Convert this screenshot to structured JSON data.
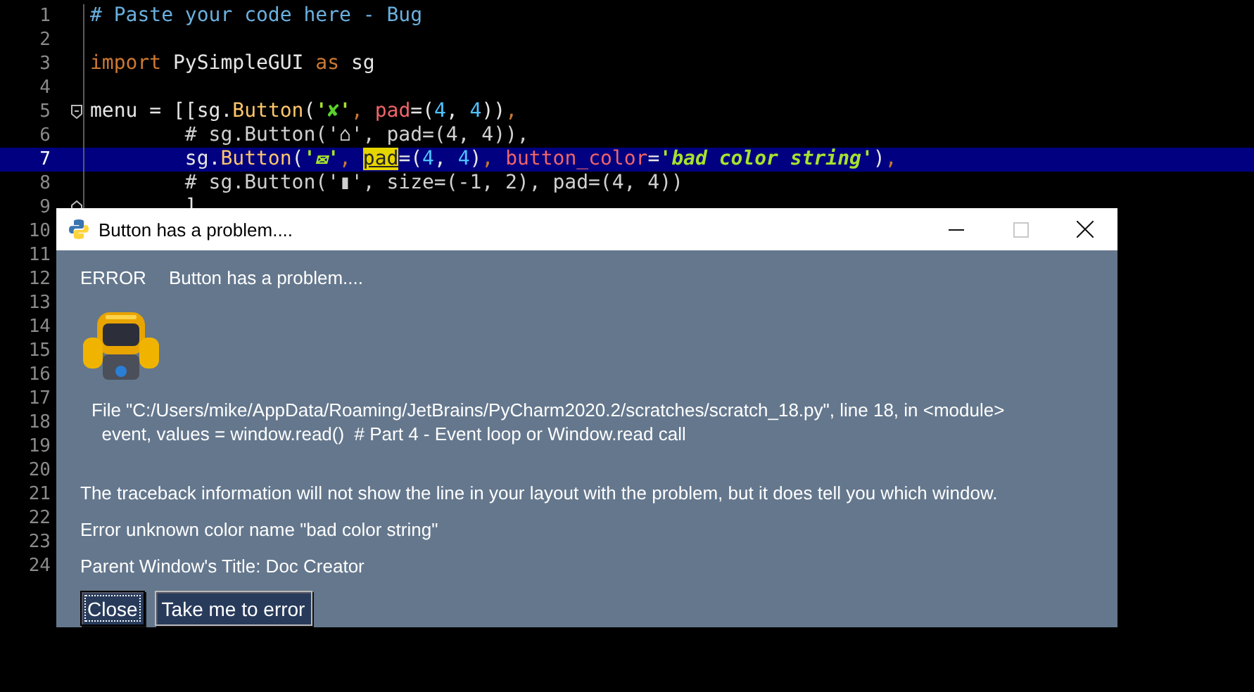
{
  "editor": {
    "lines": [
      {
        "number": "1",
        "selected": false,
        "tokens": [
          {
            "kind": "comment",
            "text": "# Paste your code here - Bug"
          }
        ]
      },
      {
        "number": "2",
        "selected": false
      },
      {
        "number": "3",
        "selected": false,
        "tokens": [
          {
            "kind": "keyword",
            "text": "import"
          },
          {
            "kind": "plain",
            "text": " PySimpleGUI "
          },
          {
            "kind": "keyword",
            "text": "as"
          },
          {
            "kind": "plain",
            "text": " sg"
          }
        ]
      },
      {
        "number": "4",
        "selected": false
      },
      {
        "number": "5",
        "selected": false,
        "fold_start": true,
        "tokens": [
          {
            "kind": "plain",
            "text": "menu = [[sg."
          },
          {
            "kind": "func",
            "text": "Button"
          },
          {
            "kind": "plain",
            "text": "("
          },
          {
            "kind": "string",
            "text": "'"
          },
          {
            "kind": "mark",
            "text": "✘"
          },
          {
            "kind": "string",
            "text": "'"
          },
          {
            "kind": "punct",
            "text": ", "
          },
          {
            "kind": "param",
            "text": "pad"
          },
          {
            "kind": "plain",
            "text": "=("
          },
          {
            "kind": "number",
            "text": "4"
          },
          {
            "kind": "plain",
            "text": ", "
          },
          {
            "kind": "number",
            "text": "4"
          },
          {
            "kind": "plain",
            "text": "))"
          },
          {
            "kind": "punct",
            "text": ","
          }
        ]
      },
      {
        "number": "6",
        "selected": false,
        "tokens": [
          {
            "kind": "commented",
            "text": "        # sg.Button('⌂', pad=(4, 4)),"
          }
        ]
      },
      {
        "number": "7",
        "selected": true,
        "tokens": [
          {
            "kind": "plain",
            "text": "        sg."
          },
          {
            "kind": "func",
            "text": "Button"
          },
          {
            "kind": "plain",
            "text": "("
          },
          {
            "kind": "string",
            "text": "'✉'"
          },
          {
            "kind": "punct",
            "text": ", "
          },
          {
            "kind": "match",
            "text": "pad"
          },
          {
            "kind": "plain",
            "text": "=("
          },
          {
            "kind": "number",
            "text": "4"
          },
          {
            "kind": "plain",
            "text": ", "
          },
          {
            "kind": "number",
            "text": "4"
          },
          {
            "kind": "plain",
            "text": ")"
          },
          {
            "kind": "punct",
            "text": ", "
          },
          {
            "kind": "param",
            "text": "button_color"
          },
          {
            "kind": "plain",
            "text": "="
          },
          {
            "kind": "string",
            "text": "'bad color string'"
          },
          {
            "kind": "plain",
            "text": ")"
          },
          {
            "kind": "punct",
            "text": ","
          }
        ]
      },
      {
        "number": "8",
        "selected": false,
        "tokens": [
          {
            "kind": "commented",
            "text": "        # sg.Button('▮', size=(-1, 2), pad=(4, 4))"
          }
        ]
      },
      {
        "number": "9",
        "selected": false,
        "fold_end": true,
        "tokens": [
          {
            "kind": "plain",
            "text": "        ]"
          }
        ]
      },
      {
        "number": "10",
        "selected": false
      },
      {
        "number": "11",
        "selected": false
      },
      {
        "number": "12",
        "selected": false
      },
      {
        "number": "13",
        "selected": false
      },
      {
        "number": "14",
        "selected": false
      },
      {
        "number": "15",
        "selected": false
      },
      {
        "number": "16",
        "selected": false
      },
      {
        "number": "17",
        "selected": false
      },
      {
        "number": "18",
        "selected": false
      },
      {
        "number": "19",
        "selected": false
      },
      {
        "number": "20",
        "selected": false
      },
      {
        "number": "21",
        "selected": false
      },
      {
        "number": "22",
        "selected": false
      },
      {
        "number": "23",
        "selected": false
      },
      {
        "number": "24",
        "selected": false
      }
    ]
  },
  "dialog": {
    "title": "Button has a problem....",
    "title_buttons": [
      {
        "kind": "minimize",
        "disabled": false
      },
      {
        "kind": "maximize",
        "disabled": true
      },
      {
        "kind": "close",
        "disabled": false
      }
    ],
    "severity": "ERROR",
    "message": "Button has a problem....",
    "traceback": [
      "File \"C:/Users/mike/AppData/Roaming/JetBrains/PyCharm2020.2/scratches/scratch_18.py\", line 18, in <module>",
      "  event, values = window.read()  # Part 4 - Event loop or Window.read call"
    ],
    "notes": [
      "The traceback information will not show the line in your layout with the problem, but it does tell you which window.",
      "Error unknown color name \"bad color string\"",
      "Parent Window's Title: Doc Creator"
    ],
    "buttons": [
      {
        "label": "Close",
        "focused": true
      },
      {
        "label": "Take me to error",
        "focused": false
      }
    ]
  }
}
